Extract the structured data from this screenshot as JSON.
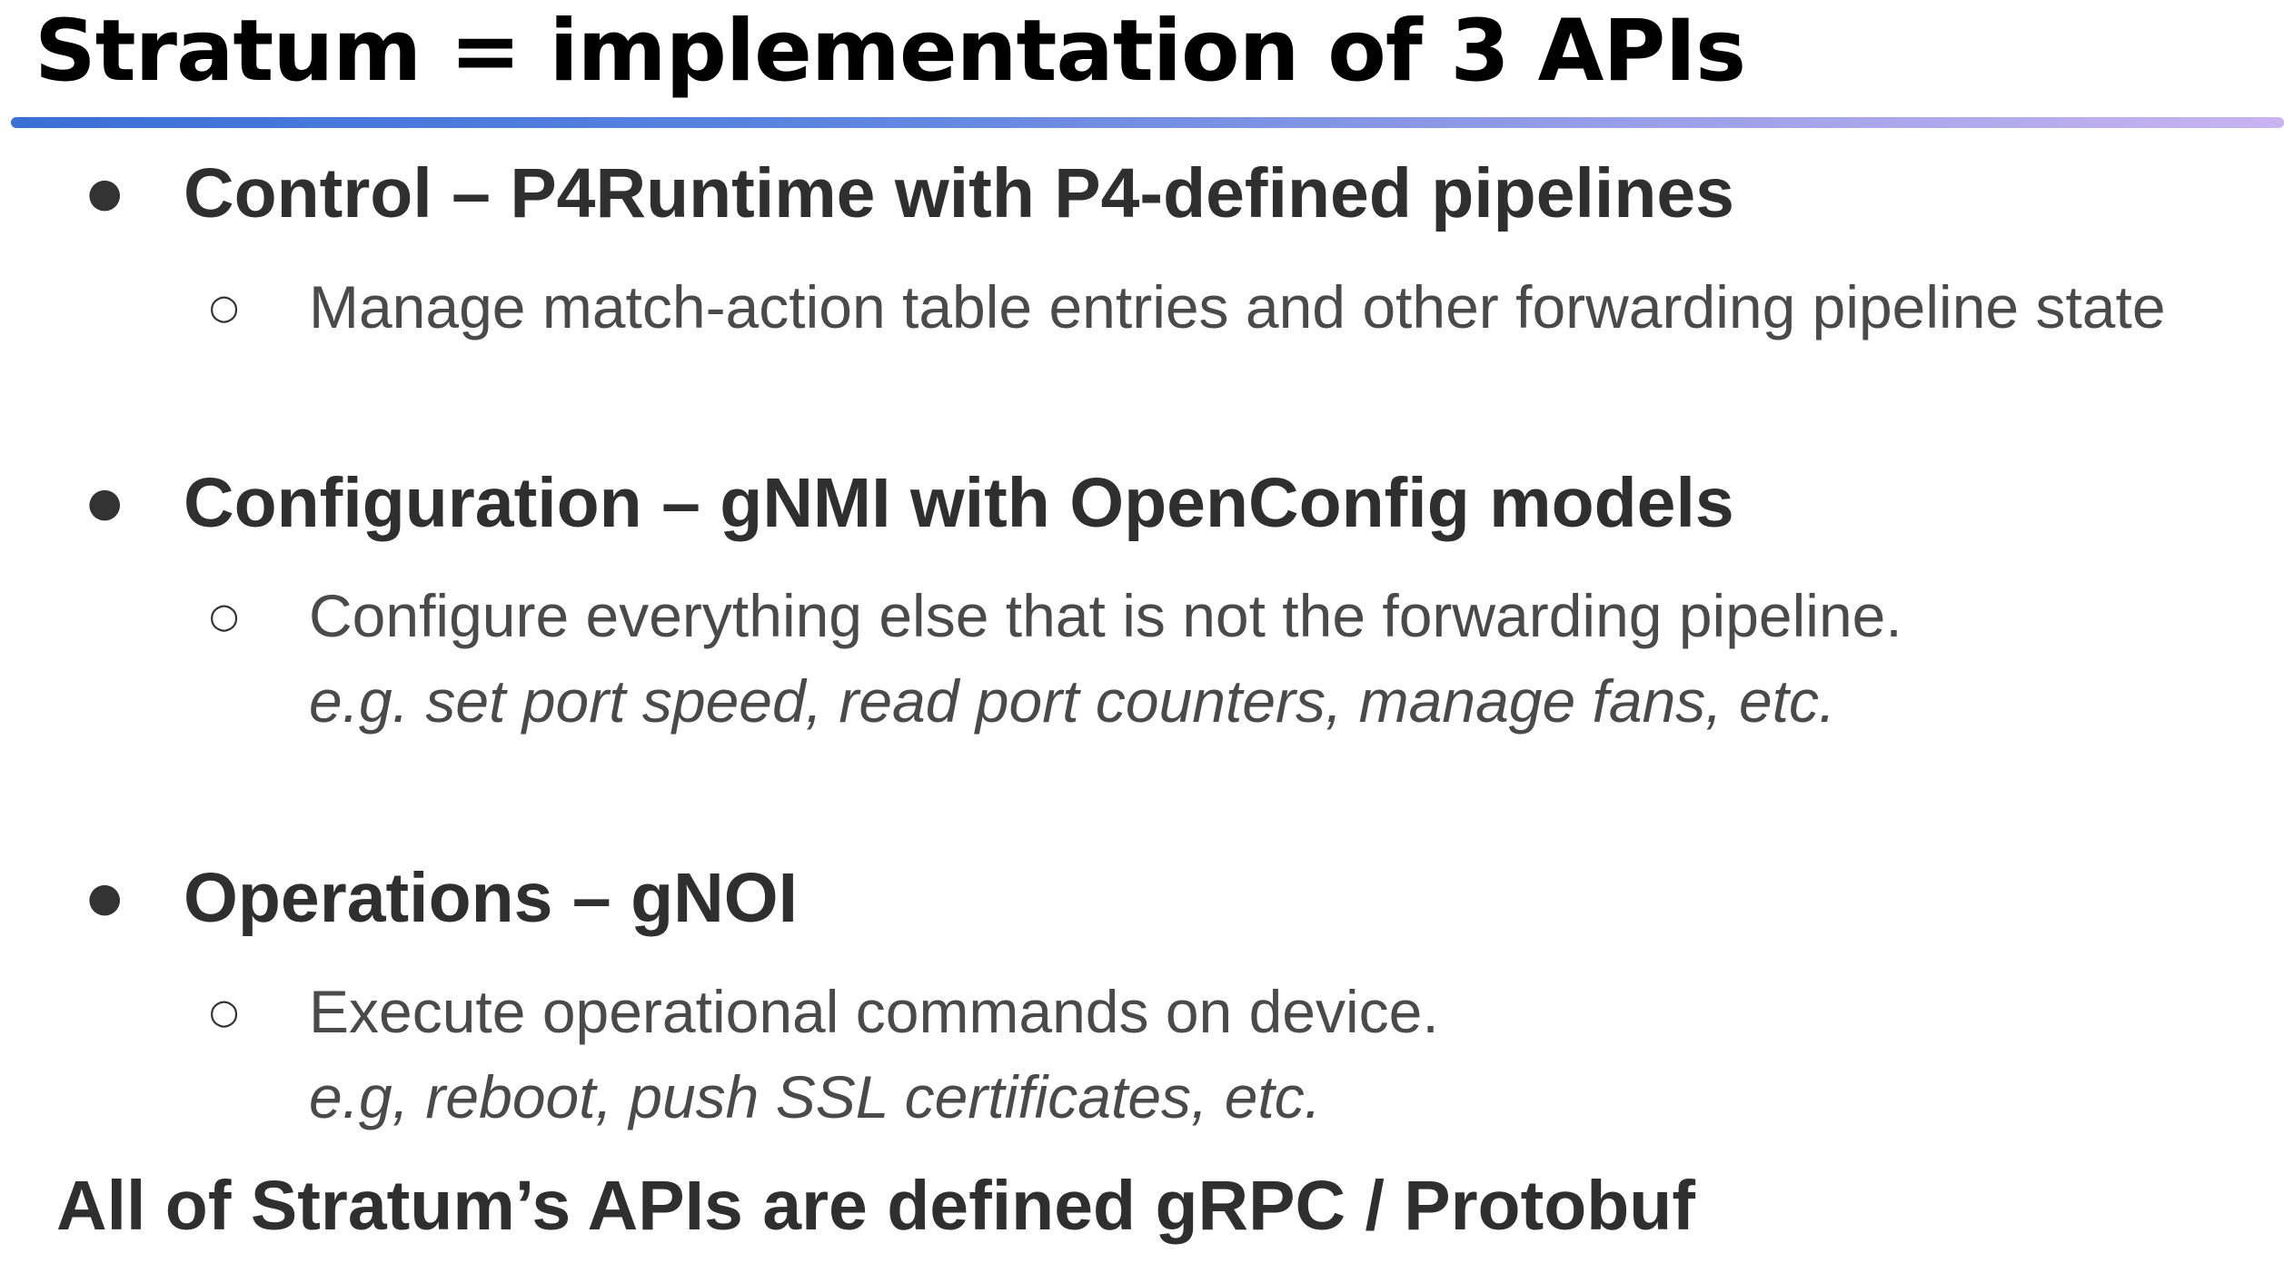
{
  "slide": {
    "title": "Stratum = implementation of 3 APIs",
    "bullets": [
      {
        "heading": "Control – P4Runtime with P4-defined pipelines",
        "detail": "Manage match-action table entries and other forwarding pipeline state",
        "example": ""
      },
      {
        "heading": "Configuration  – gNMI with OpenConfig models",
        "detail": "Configure everything else that is not the forwarding pipeline.",
        "example": "e.g. set port speed, read port counters, manage fans, etc."
      },
      {
        "heading": "Operations – gNOI",
        "detail": "Execute operational commands on device.",
        "example": "e.g, reboot, push SSL certificates, etc."
      }
    ],
    "footer": "All of Stratum’s APIs are defined gRPC / Protobuf",
    "bullet_symbol": "●",
    "sub_bullet_symbol": "○"
  },
  "colors": {
    "title": "#000000",
    "heading": "#2f2f2f",
    "body": "#4a4a4a",
    "rule_start": "#3a6fd6",
    "rule_end": "#c8b4f0"
  }
}
